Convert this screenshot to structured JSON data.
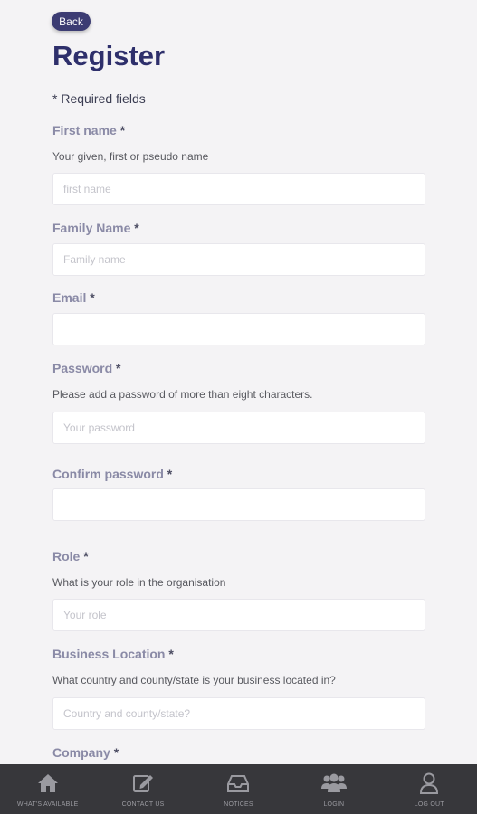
{
  "header": {
    "back_label": "Back",
    "title": "Register",
    "required_note": "* Required fields"
  },
  "form": {
    "first_name": {
      "label": "First name",
      "hint": "Your given, first or pseudo name",
      "placeholder": "first name",
      "value": ""
    },
    "family_name": {
      "label": "Family Name",
      "placeholder": "Family name",
      "value": ""
    },
    "email": {
      "label": "Email",
      "placeholder": "",
      "value": ""
    },
    "password": {
      "label": "Password",
      "hint": "Please add a password of more than eight characters.",
      "placeholder": "Your password",
      "value": ""
    },
    "confirm_password": {
      "label": "Confirm password",
      "placeholder": "",
      "value": ""
    },
    "role": {
      "label": "Role",
      "hint": "What is your role in the organisation",
      "placeholder": "Your role",
      "value": ""
    },
    "business_location": {
      "label": "Business Location",
      "hint": "What country and county/state is your business located in?",
      "placeholder": "Country and county/state?",
      "value": ""
    },
    "company": {
      "label": "Company"
    },
    "required_marker": "*"
  },
  "nav": {
    "items": [
      {
        "label": "WHAT'S AVAILABLE",
        "icon": "home-icon"
      },
      {
        "label": "CONTACT US",
        "icon": "edit-icon"
      },
      {
        "label": "NOTICES",
        "icon": "inbox-icon"
      },
      {
        "label": "LOGIN",
        "icon": "users-icon"
      },
      {
        "label": "LOG OUT",
        "icon": "user-icon"
      }
    ]
  },
  "colors": {
    "accent": "#3c3c73",
    "title": "#2e2f6b",
    "label": "#8a8aa6",
    "background": "#f4f3f5",
    "navbar": "#37373b"
  }
}
